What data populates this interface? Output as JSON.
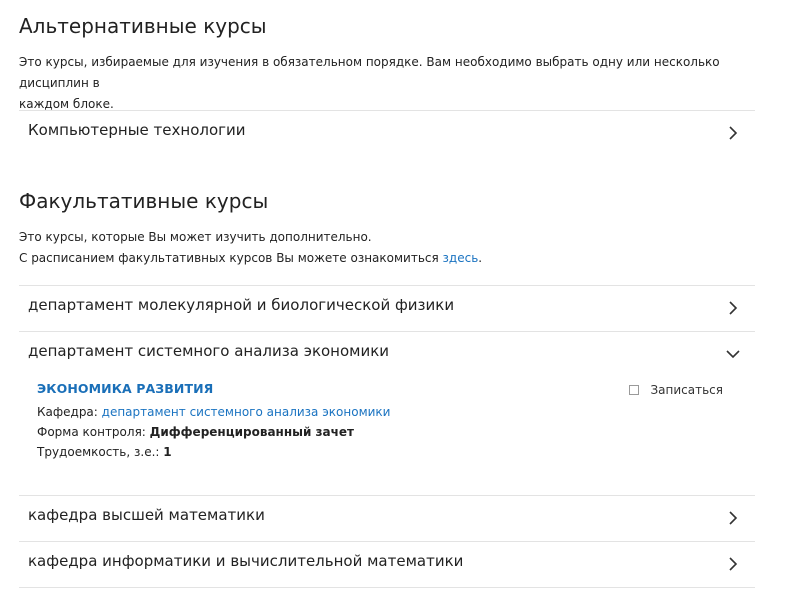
{
  "alternative": {
    "title": "Альтернативные курсы",
    "desc_line1": "Это курсы, избираемые для изучения в обязательном порядке. Вам необходимо выбрать одну или несколько дисциплин в",
    "desc_line2": "каждом блоке.",
    "items": [
      {
        "label": "Компьютерные технологии",
        "expanded": false
      }
    ]
  },
  "optional": {
    "title": "Факультативные курсы",
    "desc_line1": "Это курсы, которые Вы может изучить дополнительно.",
    "desc_line2_prefix": "С расписанием факультативных курсов Вы можете ознакомиться ",
    "desc_link": "здесь",
    "desc_line2_suffix": ".",
    "items": [
      {
        "label": "департамент молекулярной и биологической физики",
        "expanded": false
      },
      {
        "label": "департамент системного анализа экономики",
        "expanded": true
      },
      {
        "label": "кафедра высшей математики",
        "expanded": false
      },
      {
        "label": "кафедра информатики и вычислительной математики",
        "expanded": false
      }
    ],
    "course": {
      "name": "ЭКОНОМИКА РАЗВИТИЯ",
      "dept_label": "Кафедра: ",
      "dept_value": "департамент системного анализа экономики",
      "control_label": "Форма контроля: ",
      "control_value": "Дифференцированный зачет",
      "credits_label": "Трудоемкость, з.е.: ",
      "credits_value": "1",
      "enroll_label": "Записаться"
    }
  },
  "colors": {
    "link": "#1a73c1",
    "divider": "#e3e3e3",
    "text": "#222222"
  }
}
